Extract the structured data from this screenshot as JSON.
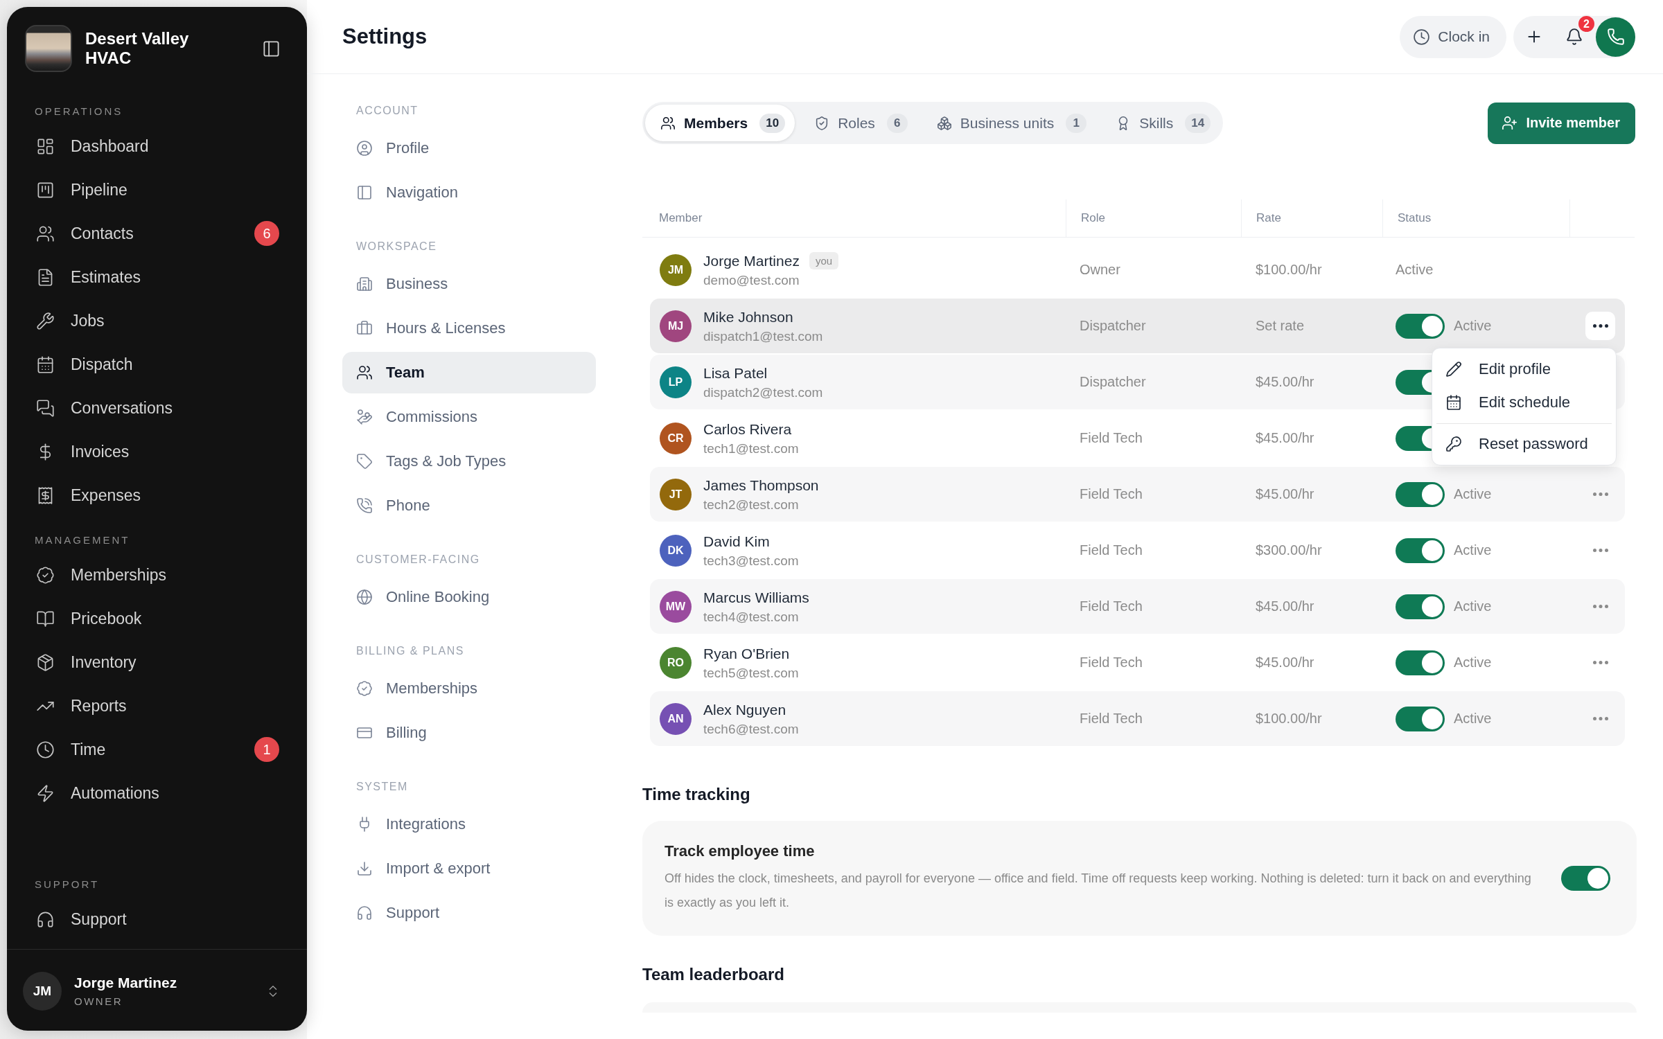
{
  "sidebar": {
    "brand": "Desert Valley HVAC",
    "sections": [
      {
        "label": "OPERATIONS",
        "items": [
          {
            "label": "Dashboard",
            "selected": false
          },
          {
            "label": "Pipeline",
            "selected": false
          },
          {
            "label": "Contacts",
            "badge": "6",
            "selected": false
          },
          {
            "label": "Estimates",
            "selected": false
          },
          {
            "label": "Jobs",
            "selected": false
          },
          {
            "label": "Dispatch",
            "selected": false
          },
          {
            "label": "Conversations",
            "selected": false
          },
          {
            "label": "Invoices",
            "selected": false
          },
          {
            "label": "Expenses",
            "selected": false
          }
        ]
      },
      {
        "label": "MANAGEMENT",
        "items": [
          {
            "label": "Memberships",
            "selected": false
          },
          {
            "label": "Pricebook",
            "selected": false
          },
          {
            "label": "Inventory",
            "selected": false
          },
          {
            "label": "Reports",
            "selected": false
          },
          {
            "label": "Time",
            "badge": "1",
            "selected": false
          },
          {
            "label": "Automations",
            "selected": false
          }
        ]
      },
      {
        "label": "SUPPORT",
        "items": [
          {
            "label": "Support",
            "selected": false
          }
        ]
      }
    ],
    "user": {
      "initials": "JM",
      "name": "Jorge Martinez",
      "role": "OWNER"
    }
  },
  "header": {
    "title": "Settings",
    "clock_in": "Clock in",
    "notification_count": "2"
  },
  "settings_nav": {
    "sections": [
      {
        "label": "ACCOUNT",
        "items": [
          {
            "label": "Profile",
            "selected": false
          },
          {
            "label": "Navigation",
            "selected": false
          }
        ]
      },
      {
        "label": "WORKSPACE",
        "items": [
          {
            "label": "Business",
            "selected": false
          },
          {
            "label": "Hours & Licenses",
            "selected": false
          },
          {
            "label": "Team",
            "selected": true
          },
          {
            "label": "Commissions",
            "selected": false
          },
          {
            "label": "Tags & Job Types",
            "selected": false
          },
          {
            "label": "Phone",
            "selected": false
          }
        ]
      },
      {
        "label": "CUSTOMER-FACING",
        "items": [
          {
            "label": "Online Booking",
            "selected": false
          }
        ]
      },
      {
        "label": "BILLING & PLANS",
        "items": [
          {
            "label": "Memberships",
            "selected": false
          },
          {
            "label": "Billing",
            "selected": false
          }
        ]
      },
      {
        "label": "SYSTEM",
        "items": [
          {
            "label": "Integrations",
            "selected": false
          },
          {
            "label": "Import & export",
            "selected": false
          },
          {
            "label": "Support",
            "selected": false
          }
        ]
      }
    ]
  },
  "tabs": [
    {
      "label": "Members",
      "count": "10",
      "selected": true
    },
    {
      "label": "Roles",
      "count": "6",
      "selected": false
    },
    {
      "label": "Business units",
      "count": "1",
      "selected": false
    },
    {
      "label": "Skills",
      "count": "14",
      "selected": false
    }
  ],
  "invite_button": "Invite member",
  "table": {
    "columns": [
      "Member",
      "Role",
      "Rate",
      "Status"
    ],
    "rows": [
      {
        "initials": "JM",
        "color": "#7f7c10",
        "name": "Jorge Martinez",
        "you": "you",
        "email": "demo@test.com",
        "role": "Owner",
        "rate": "$100.00/hr",
        "status": "Active",
        "hovered": false,
        "more_button": false,
        "menu_open": false
      },
      {
        "initials": "MJ",
        "color": "#a0467f",
        "name": "Mike Johnson",
        "email": "dispatch1@test.com",
        "role": "Dispatcher",
        "rate": "Set rate",
        "enabled": true,
        "status": "Active",
        "hovered": true,
        "more_button": true,
        "menu_open": true
      },
      {
        "initials": "LP",
        "color": "#0d8486",
        "name": "Lisa Patel",
        "email": "dispatch2@test.com",
        "role": "Dispatcher",
        "rate": "$45.00/hr",
        "enabled": true,
        "hovered": false,
        "more_button": false,
        "menu_open": false
      },
      {
        "initials": "CR",
        "color": "#b0541f",
        "name": "Carlos Rivera",
        "email": "tech1@test.com",
        "role": "Field Tech",
        "rate": "$45.00/hr",
        "enabled": true,
        "hovered": false,
        "more_button": false,
        "menu_open": false
      },
      {
        "initials": "JT",
        "color": "#93690c",
        "name": "James Thompson",
        "email": "tech2@test.com",
        "role": "Field Tech",
        "rate": "$45.00/hr",
        "enabled": true,
        "status": "Active",
        "hovered": false,
        "more_button": true,
        "menu_open": false
      },
      {
        "initials": "DK",
        "color": "#4d62bd",
        "name": "David Kim",
        "email": "tech3@test.com",
        "role": "Field Tech",
        "rate": "$300.00/hr",
        "enabled": true,
        "status": "Active",
        "hovered": false,
        "more_button": true,
        "menu_open": false
      },
      {
        "initials": "MW",
        "color": "#9a4b9e",
        "name": "Marcus Williams",
        "email": "tech4@test.com",
        "role": "Field Tech",
        "rate": "$45.00/hr",
        "enabled": true,
        "status": "Active",
        "hovered": false,
        "more_button": true,
        "menu_open": false
      },
      {
        "initials": "RO",
        "color": "#4b8530",
        "name": "Ryan O'Brien",
        "email": "tech5@test.com",
        "role": "Field Tech",
        "rate": "$45.00/hr",
        "enabled": true,
        "status": "Active",
        "hovered": false,
        "more_button": true,
        "menu_open": false
      },
      {
        "initials": "AN",
        "color": "#7650b3",
        "name": "Alex Nguyen",
        "email": "tech6@test.com",
        "role": "Field Tech",
        "rate": "$100.00/hr",
        "enabled": true,
        "status": "Active",
        "hovered": false,
        "more_button": true,
        "menu_open": false
      }
    ]
  },
  "row_menu": [
    {
      "label": "Edit profile",
      "separated": false
    },
    {
      "label": "Edit schedule",
      "separated": false
    },
    {
      "label": "Reset password",
      "separated": true
    }
  ],
  "time_tracking": {
    "heading": "Time tracking",
    "title": "Track employee time",
    "description": "Off hides the clock, timesheets, and payroll for everyone — office and field. Time off requests keep working. Nothing is deleted: turn it back on and everything is exactly as you left it.",
    "on": true
  },
  "leaderboard": {
    "heading": "Team leaderboard"
  }
}
